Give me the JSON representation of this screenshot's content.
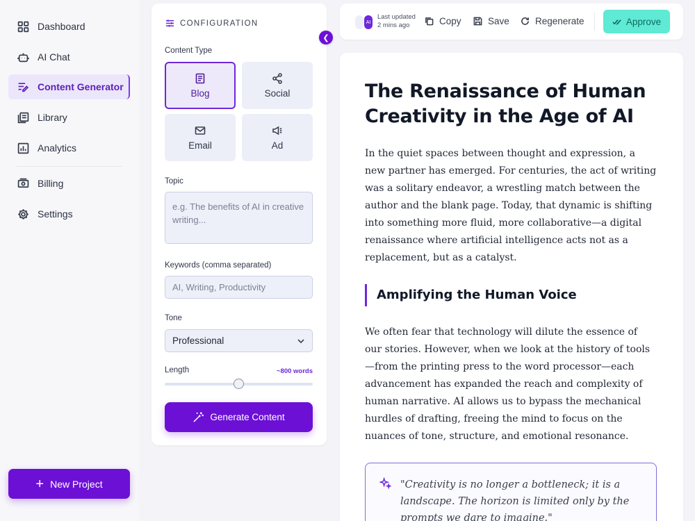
{
  "sidebar": {
    "items": [
      {
        "label": "Dashboard",
        "icon": "grid-icon"
      },
      {
        "label": "AI Chat",
        "icon": "robot-icon"
      },
      {
        "label": "Content Generator",
        "icon": "pen-lines-icon",
        "active": true
      },
      {
        "label": "Library",
        "icon": "library-icon"
      },
      {
        "label": "Analytics",
        "icon": "chart-icon"
      },
      {
        "label": "Billing",
        "icon": "money-icon"
      },
      {
        "label": "Settings",
        "icon": "gear-icon"
      }
    ],
    "new_project_label": "New Project"
  },
  "config": {
    "header": "CONFIGURATION",
    "content_type_label": "Content Type",
    "content_types": [
      {
        "label": "Blog",
        "icon": "document-icon",
        "selected": true
      },
      {
        "label": "Social",
        "icon": "share-icon"
      },
      {
        "label": "Email",
        "icon": "mail-icon"
      },
      {
        "label": "Ad",
        "icon": "megaphone-icon"
      }
    ],
    "topic_label": "Topic",
    "topic_placeholder": "e.g. The benefits of AI in creative writing...",
    "keywords_label": "Keywords (comma separated)",
    "keywords_placeholder": "AI, Writing, Productivity",
    "tone_label": "Tone",
    "tone_value": "Professional",
    "length_label": "Length",
    "length_value": "~800 words",
    "length_slider_fraction": 0.5,
    "generate_label": "Generate Content"
  },
  "toolbar": {
    "ai_badge": "AI",
    "updated_line1": "Last updated",
    "updated_line2": "2 mins ago",
    "copy_label": "Copy",
    "save_label": "Save",
    "regenerate_label": "Regenerate",
    "approve_label": "Approve"
  },
  "article": {
    "title": "The Renaissance of Human Creativity in the Age of AI",
    "paragraph1": "In the quiet spaces between thought and expression, a new partner has emerged. For centuries, the act of writing was a solitary endeavor, a wrestling match between the author and the blank page. Today, that dynamic is shifting into something more fluid, more collaborative—a digital renaissance where artificial intelligence acts not as a replacement, but as a catalyst.",
    "heading2": "Amplifying the Human Voice",
    "paragraph2": "We often fear that technology will dilute the essence of our stories. However, when we look at the history of tools—from the printing press to the word processor—each advancement has expanded the reach and complexity of human narrative. AI allows us to bypass the mechanical hurdles of drafting, freeing the mind to focus on the nuances of tone, structure, and emotional resonance.",
    "quote": "\"Creativity is no longer a bottleneck; it is a landscape. The horizon is limited only by the prompts we dare to imagine.\""
  },
  "colors": {
    "accent": "#6d10d6",
    "accent_soft": "#ece6fb",
    "approve": "#5eead4",
    "background": "#f4f4f8"
  }
}
